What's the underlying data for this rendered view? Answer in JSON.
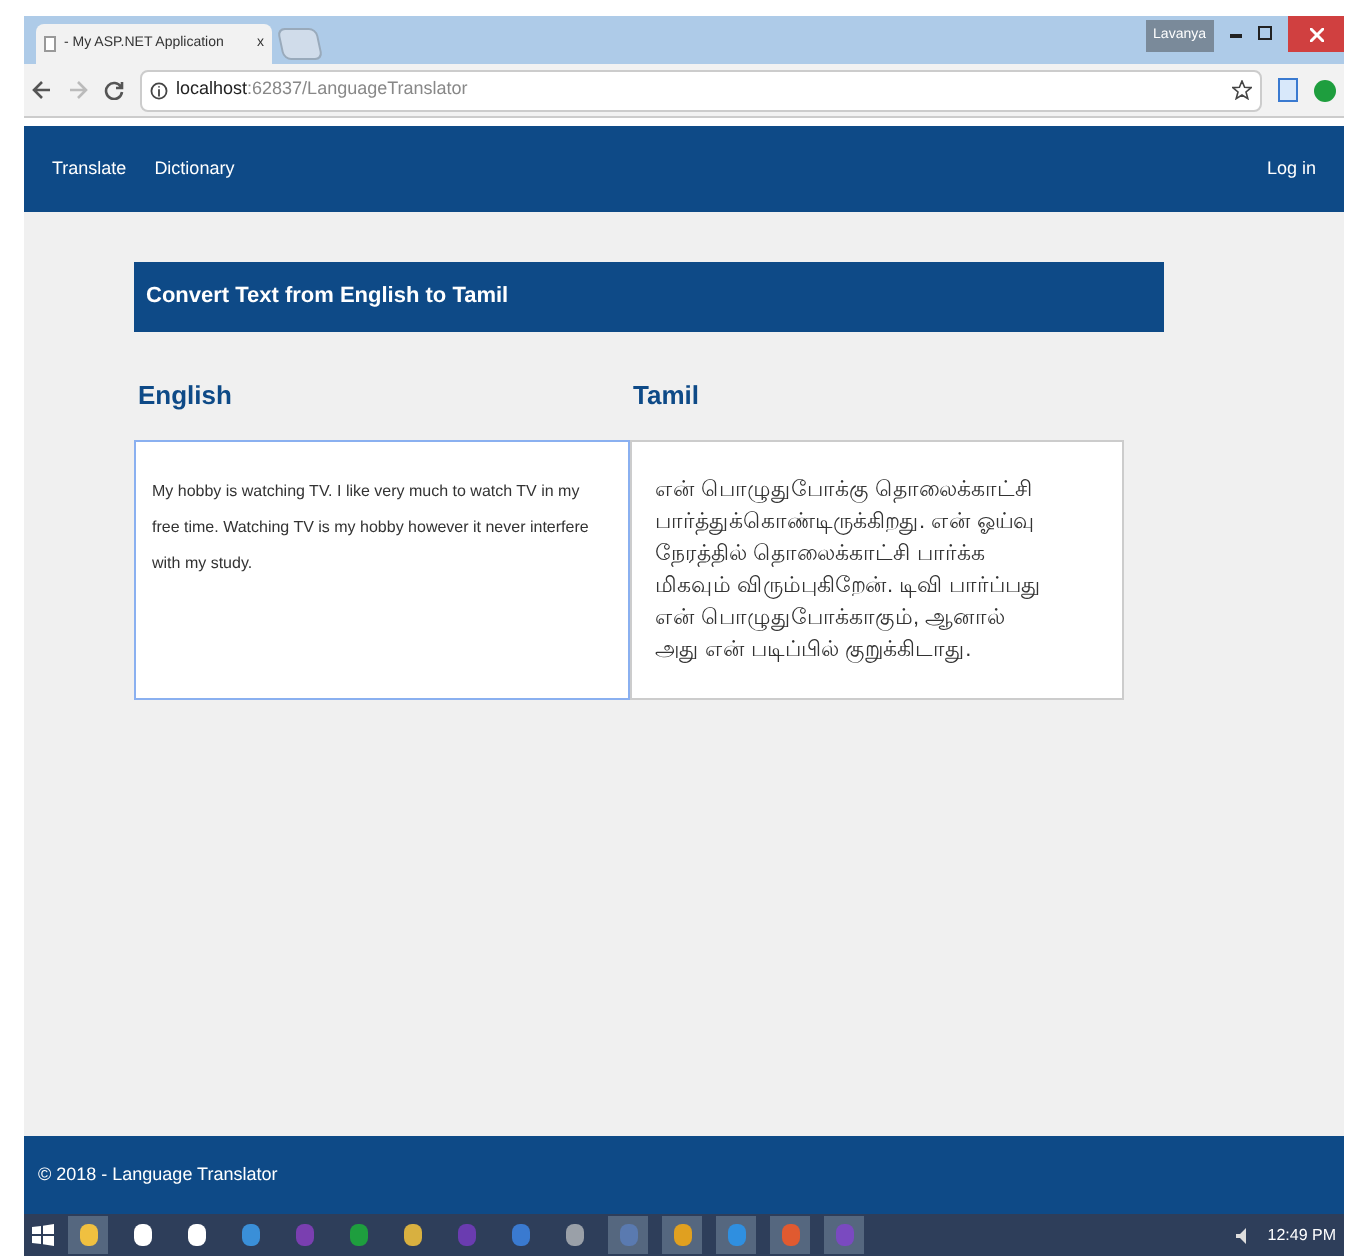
{
  "browser": {
    "tab_title": "- My ASP.NET Application",
    "tab_close": "x",
    "profile": "Lavanya",
    "url_host": "localhost",
    "url_path": ":62837/LanguageTranslator"
  },
  "nav": {
    "items": [
      {
        "label": "Translate"
      },
      {
        "label": "Dictionary"
      }
    ],
    "login": "Log in"
  },
  "panel_title": "Convert Text from English to Tamil",
  "source": {
    "label": "English",
    "value": "My hobby is watching TV. I like very much to watch TV in my free time. Watching TV is my hobby however it never interfere with my study.",
    "focused": true
  },
  "target": {
    "label": "Tamil",
    "value": "என் பொழுதுபோக்கு தொலைக்காட்சி பார்த்துக்கொண்டிருக்கிறது. என் ஓய்வு நேரத்தில் தொலைக்காட்சி பார்க்க மிகவும் விரும்புகிறேன். டிவி பார்ப்பது என் பொழுதுபோக்காகும், ஆனால் அது என் படிப்பில் குறுக்கிடாது.",
    "focused": false
  },
  "footer": "© 2018 - Language Translator",
  "taskbar": {
    "apps": [
      {
        "color": "#f0c040",
        "active": true
      },
      {
        "color": "#ffffff",
        "active": false
      },
      {
        "color": "#ffffff",
        "active": false
      },
      {
        "color": "#3a8fd8",
        "active": false
      },
      {
        "color": "#7a3fb0",
        "active": false
      },
      {
        "color": "#1e9e3e",
        "active": false
      },
      {
        "color": "#d8b040",
        "active": false
      },
      {
        "color": "#6a3cb0",
        "active": false
      },
      {
        "color": "#3a7ad0",
        "active": false
      },
      {
        "color": "#9aa0a8",
        "active": false
      },
      {
        "color": "#5a7ab0",
        "active": true
      },
      {
        "color": "#e0a020",
        "active": true
      },
      {
        "color": "#2f8fe0",
        "active": true
      },
      {
        "color": "#e05a30",
        "active": true
      },
      {
        "color": "#7a4ac0",
        "active": true
      }
    ],
    "clock": "12:49 PM"
  }
}
